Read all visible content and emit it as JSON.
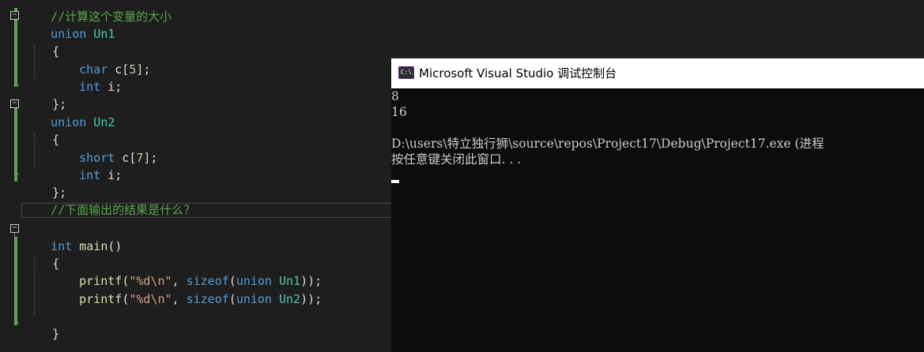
{
  "editor": {
    "lines": {
      "top_comment": "//计算这个变量的大小",
      "u1_decl_kw": "union",
      "u1_decl_name": " Un1",
      "u1_open": "{",
      "u1_m1_type": "char",
      "u1_m1_rest": " c[",
      "u1_m1_num": "5",
      "u1_m1_end": "];",
      "u1_m2_type": "int",
      "u1_m2_rest": " i;",
      "u1_close": "};",
      "u2_decl_kw": "union",
      "u2_decl_name": " Un2",
      "u2_open": "{",
      "u2_m1_type": "short",
      "u2_m1_rest": " c[",
      "u2_m1_num": "7",
      "u2_m1_end": "];",
      "u2_m2_type": "int",
      "u2_m2_rest": " i;",
      "u2_close": "};",
      "question_comment": "//下面输出的结果是什么？",
      "main_type": "int",
      "main_name": " main",
      "main_parens": "()",
      "main_open": "{",
      "p1_fn": "printf",
      "p1_paren": "(",
      "p1_str": "\"%d\\n\"",
      "p1_comma": ", ",
      "p1_sizeof": "sizeof",
      "p1_paren2": "(",
      "p1_union": "union",
      "p1_name": " Un1",
      "p1_end": "));",
      "p2_fn": "printf",
      "p2_paren": "(",
      "p2_str": "\"%d\\n\"",
      "p2_comma": ", ",
      "p2_sizeof": "sizeof",
      "p2_paren2": "(",
      "p2_union": "union",
      "p2_name": " Un2",
      "p2_end": "));",
      "main_close": "}"
    },
    "fold_glyph": "−"
  },
  "console": {
    "icon_label": "C:\\",
    "title": "Microsoft Visual Studio 调试控制台",
    "output": [
      "8",
      "16",
      "",
      "D:\\users\\特立独行狮\\source\\repos\\Project17\\Debug\\Project17.exe (进程",
      "按任意键关闭此窗口. . ."
    ]
  },
  "colors": {
    "editor_bg": "#1e1e1e",
    "keyword": "#569cd6",
    "type_name": "#4ec9b0",
    "function": "#dcdcaa",
    "string": "#d69d85",
    "comment": "#57a64a",
    "console_bg": "#0c0c0c"
  }
}
